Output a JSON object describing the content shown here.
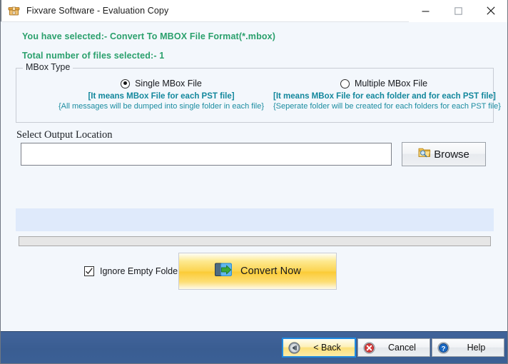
{
  "window": {
    "title": "Fixvare Software - Evaluation Copy",
    "app_icon": "archive-box-icon",
    "controls": {
      "minimize": "minimize-icon",
      "maximize": "maximize-icon",
      "close": "close-icon"
    }
  },
  "info": {
    "line1": "You have selected:- Convert To MBOX File Format(*.mbox)",
    "line2": "Total number of files selected:- 1",
    "color": "#2aa06c"
  },
  "mbox_group": {
    "title": "MBox Type",
    "options": [
      {
        "label": "Single MBox File",
        "selected": true,
        "note_bold": "[It means MBox File for each PST file]",
        "note_sub": "{All messages will be dumped into single folder in each file}"
      },
      {
        "label": "Multiple MBox File",
        "selected": false,
        "note_bold": "[It means MBox File for each folder and for each PST file]",
        "note_sub": "{Seperate folder will be created for each folders for each PST file}"
      }
    ],
    "note_color": "#12879c"
  },
  "output": {
    "label": "Select Output Location",
    "value": "",
    "placeholder": "",
    "browse_label": "Browse",
    "browse_icon": "folder-search-icon"
  },
  "progress": {
    "value": 0,
    "list_panel_color": "#dfeafb",
    "bar_color": "#e6e6e6"
  },
  "actions": {
    "ignore_empty_folders_label": "Ignore Empty Folders",
    "ignore_empty_folders_checked": true,
    "convert_label": "Convert Now",
    "convert_icon": "convert-arrow-icon",
    "convert_color": "#fcd450"
  },
  "footer": {
    "back_label": "< Back",
    "back_icon": "rewind-icon",
    "cancel_label": "Cancel",
    "cancel_icon": "cancel-x-icon",
    "help_label": "Help",
    "help_icon": "help-question-icon",
    "bar_color": "#3a5d92"
  }
}
